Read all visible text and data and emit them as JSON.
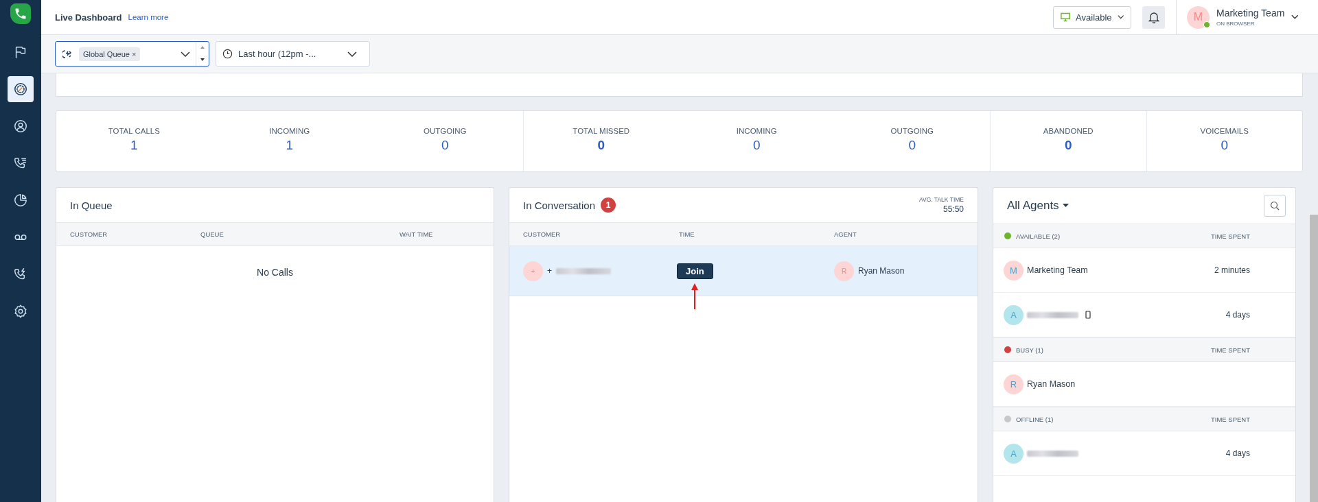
{
  "header": {
    "title": "Live Dashboard",
    "link": "Learn more",
    "status": {
      "label": "Available"
    },
    "user": {
      "avatar": "M",
      "name": "Marketing Team",
      "subtitle": "ON BROWSER",
      "online": true
    }
  },
  "sidebar": {
    "items": [
      {
        "kind": "flag",
        "selected": false
      },
      {
        "kind": "gauge",
        "selected": true
      },
      {
        "kind": "contact",
        "selected": false
      },
      {
        "kind": "calllist",
        "selected": false
      },
      {
        "kind": "pie",
        "selected": false
      },
      {
        "kind": "voicemail",
        "selected": false
      },
      {
        "kind": "callbolt",
        "selected": false
      },
      {
        "kind": "settings",
        "selected": false
      }
    ]
  },
  "filters": {
    "queue_tag": "Global Queue",
    "remove": "×",
    "time_range": "Last hour (12pm -..."
  },
  "stat_groups": [
    [
      {
        "label": "TOTAL CALLS",
        "value": "1",
        "emphasis": false
      },
      {
        "label": "INCOMING",
        "value": "1",
        "emphasis": false
      },
      {
        "label": "OUTGOING",
        "value": "0",
        "emphasis": false
      }
    ],
    [
      {
        "label": "TOTAL MISSED",
        "value": "0",
        "emphasis": true
      },
      {
        "label": "INCOMING",
        "value": "0",
        "emphasis": false
      },
      {
        "label": "OUTGOING",
        "value": "0",
        "emphasis": false
      }
    ],
    [
      {
        "label": "ABANDONED",
        "value": "0",
        "emphasis": true
      }
    ],
    [
      {
        "label": "VOICEMAILS",
        "value": "0",
        "emphasis": false
      }
    ]
  ],
  "in_queue": {
    "title": "In Queue",
    "columns": [
      "CUSTOMER",
      "QUEUE",
      "WAIT TIME"
    ],
    "empty": "No Calls"
  },
  "in_conversation": {
    "title": "In Conversation",
    "count": "1",
    "avg_label": "AVG. TALK TIME",
    "avg_value": "55:50",
    "columns": [
      "CUSTOMER",
      "TIME",
      "AGENT"
    ],
    "rows": [
      {
        "avatar": "+",
        "customer": "+",
        "customer_redacted": true,
        "action": "Join",
        "agent_avatar": "R",
        "agent": "Ryan Mason",
        "selected": true
      }
    ]
  },
  "agents": {
    "title": "All Agents",
    "groups": [
      {
        "label": "AVAILABLE (2)",
        "color": "#6cb52d",
        "time_label": "TIME SPENT",
        "agents": [
          {
            "avatar": "M",
            "color": "#fdd5d5",
            "name": "Marketing Team",
            "name_redacted": false,
            "mobile": false,
            "time": "2 minutes"
          },
          {
            "avatar": "A",
            "color": "#b3e5ec",
            "name_redacted": true,
            "mobile": true,
            "time": "4 days"
          }
        ]
      },
      {
        "label": "BUSY (1)",
        "color": "#d0413f",
        "time_label": "TIME SPENT",
        "agents": [
          {
            "avatar": "R",
            "color": "#fdd5d5",
            "name": "Ryan Mason",
            "name_redacted": false,
            "mobile": false
          }
        ]
      },
      {
        "label": "OFFLINE (1)",
        "color": "#c8c8c8",
        "time_label": "TIME SPENT",
        "agents": [
          {
            "avatar": "A",
            "color": "#b3e5ec",
            "name_redacted": true,
            "mobile": false,
            "time": "4 days"
          }
        ]
      }
    ]
  }
}
